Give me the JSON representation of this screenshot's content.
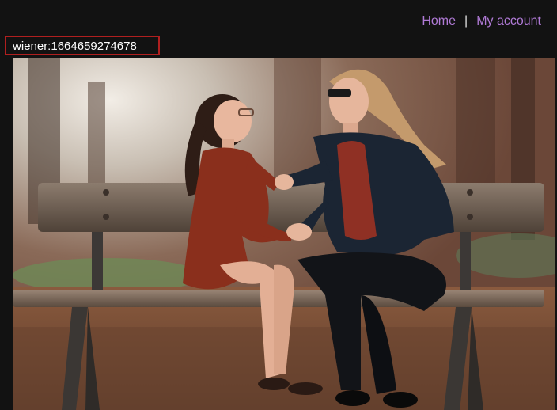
{
  "nav": {
    "home_label": "Home",
    "separator": "|",
    "account_label": "My account"
  },
  "session": {
    "text": "wiener:1664659274678"
  },
  "photo": {
    "subject": "photo of a woman and a girl holding hands on a wooden park bench"
  },
  "colors": {
    "background": "#121212",
    "link": "#b07ad6",
    "highlight_border": "#b01f1f"
  }
}
